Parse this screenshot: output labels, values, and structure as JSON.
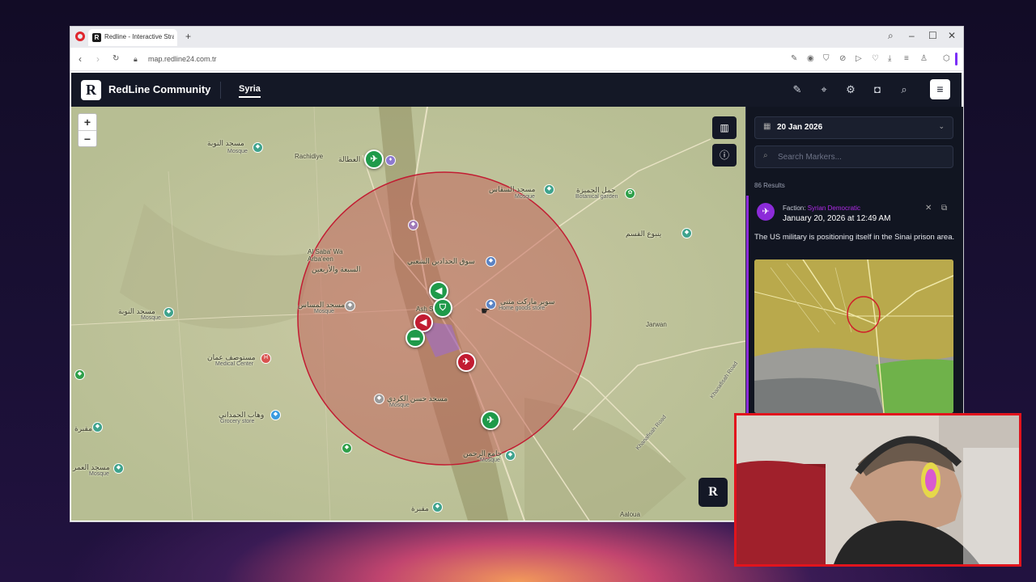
{
  "browser": {
    "tab_title": "Redline - Interactive Strat...",
    "url": "map.redline24.com.tr"
  },
  "app": {
    "logo": "R",
    "brand": "RedLine Community",
    "region_tab": "Syria"
  },
  "map": {
    "zoom_in": "+",
    "zoom_out": "−",
    "places": [
      {
        "text": "مسجد النوبة"
      },
      {
        "text": "Mosque"
      },
      {
        "text": "Rachidiye"
      },
      {
        "text": "العطالة"
      },
      {
        "text": "مسجد السقاس"
      },
      {
        "text": "Mosque"
      },
      {
        "text": "جمل الجميزة"
      },
      {
        "text": "Botanical garden"
      },
      {
        "text": "ينبوع القسم"
      },
      {
        "text": "Al Saba' Wa Arba'een"
      },
      {
        "text": "السبعة والأربعين"
      },
      {
        "text": "سوق الحدادين الشعبي"
      },
      {
        "text": "سوبر ماركت مثنى"
      },
      {
        "text": "Home goods store"
      },
      {
        "text": "Ash Shadadi"
      },
      {
        "text": "مسجد النوبة"
      },
      {
        "text": "Mosque"
      },
      {
        "text": "مسجد المساس"
      },
      {
        "text": "Mosque"
      },
      {
        "text": "Jarwan"
      },
      {
        "text": "مستوصف عمان"
      },
      {
        "text": "Medical Center"
      },
      {
        "text": "مسجد حسن الكردي"
      },
      {
        "text": "Mosque"
      },
      {
        "text": "وهاب الحمداني"
      },
      {
        "text": "Grocery store"
      },
      {
        "text": "مقبرة"
      },
      {
        "text": "مسجد العمر"
      },
      {
        "text": "Mosque"
      },
      {
        "text": "جامع الرحمن"
      },
      {
        "text": "Mosque"
      },
      {
        "text": "مقبرة"
      },
      {
        "text": "Aaloua"
      },
      {
        "text": "Khanafisah Road"
      },
      {
        "text": "Khanafisah Road"
      }
    ]
  },
  "panel": {
    "date": "20 Jan 2026",
    "search_placeholder": "Search Markers...",
    "results": "86 Results",
    "card": {
      "faction_label": "Faction:",
      "faction_value": "Syrian Democratic",
      "date": "January 20, 2026 at 12:49 AM",
      "text": "The US military is positioning itself in the Sinai prison area."
    }
  },
  "colors": {
    "header_bg": "#141826",
    "faction_accent": "#8c2bd9",
    "marker_green": "#1f9a4a",
    "marker_red": "#c21c32",
    "circle_fill": "#c0504d"
  }
}
